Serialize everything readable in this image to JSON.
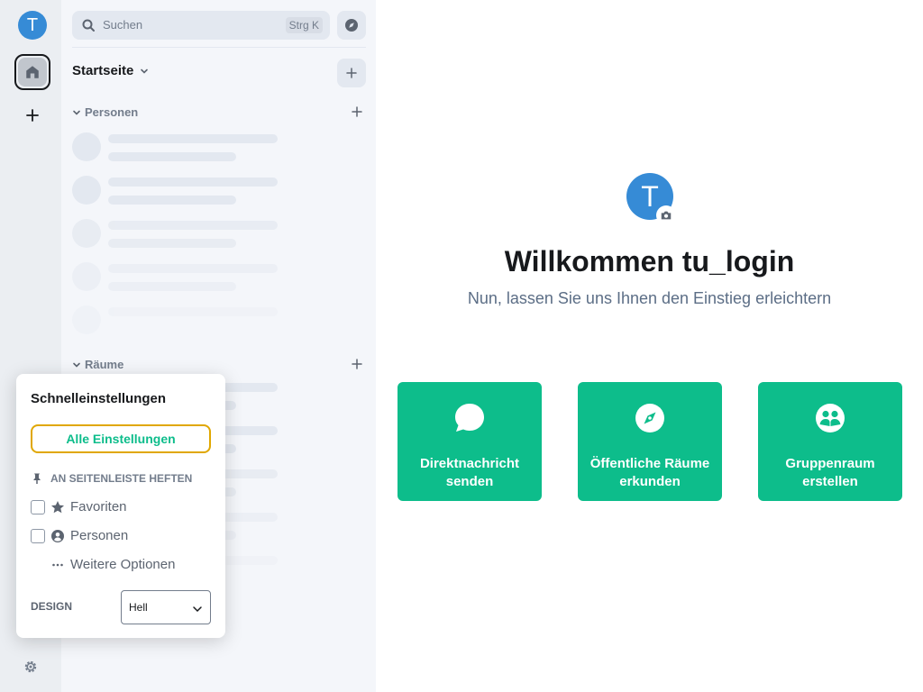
{
  "spacebar": {
    "avatar_letter": "T",
    "accent": "#368bd6"
  },
  "roomlist": {
    "search": {
      "label": "Suchen",
      "shortcut": "Strg K"
    },
    "home_title": "Startseite",
    "sections": [
      {
        "label": "Personen"
      },
      {
        "label": "Räume"
      }
    ]
  },
  "quick_settings": {
    "title": "Schnelleinstellungen",
    "all_settings": "Alle Einstellungen",
    "pin_header": "AN SEITENLEISTE HEFTEN",
    "options": [
      {
        "label": "Favoriten",
        "icon": "star-icon",
        "checked": false
      },
      {
        "label": "Personen",
        "icon": "person-icon",
        "checked": false
      },
      {
        "label": "Weitere Optionen",
        "icon": "ellipsis-icon"
      }
    ],
    "design_label": "DESIGN",
    "design_value": "Hell"
  },
  "main": {
    "avatar_letter": "T",
    "welcome": "Willkommen tu_login",
    "subtitle": "Nun, lassen Sie uns Ihnen den Einstieg erleichtern",
    "cards": [
      {
        "label": "Direktnachricht senden",
        "icon": "chat-bubble-icon"
      },
      {
        "label": "Öffentliche Räume erkunden",
        "icon": "compass-icon"
      },
      {
        "label": "Gruppenraum erstellen",
        "icon": "group-icon"
      }
    ],
    "card_color": "#0dbd8b"
  }
}
